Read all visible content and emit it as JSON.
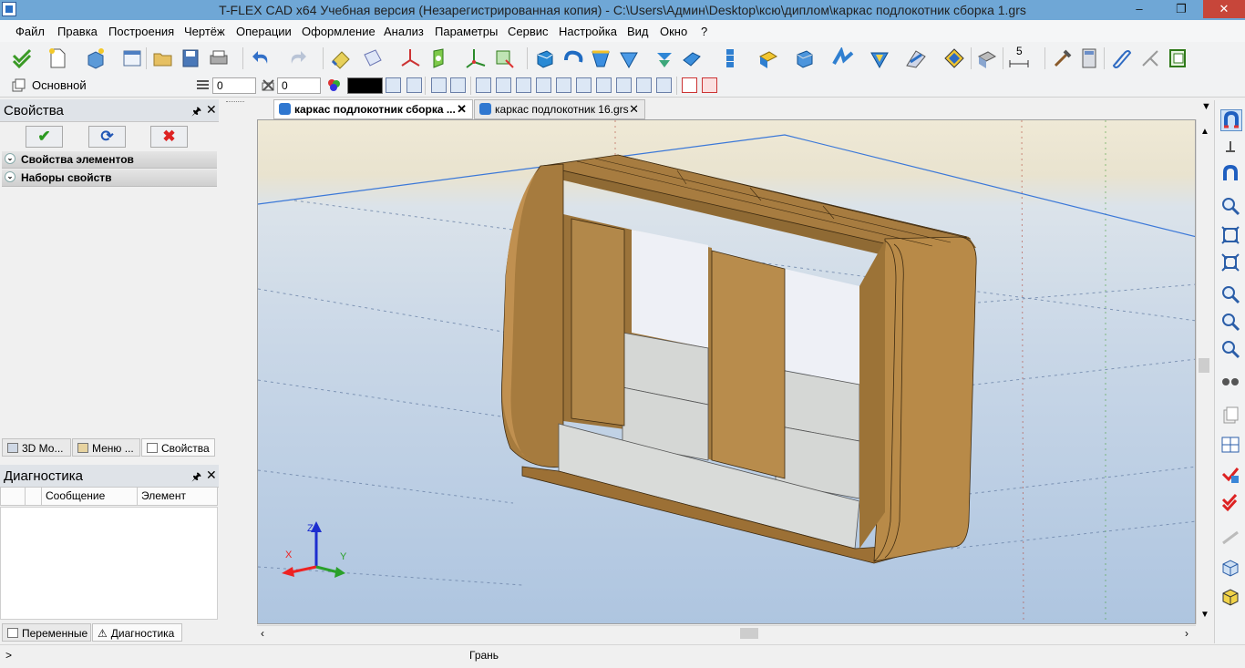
{
  "window": {
    "title": "T-FLEX CAD x64 Учебная версия (Незарегистрированная копия) - C:\\Users\\Админ\\Desktop\\ксю\\диплом\\каркас подлокотник сборка 1.grs",
    "minimize": "–",
    "maximize": "❐",
    "close": "✕"
  },
  "menu": [
    "Файл",
    "Правка",
    "Построения",
    "Чертёж",
    "Операции",
    "Оформление",
    "Анализ",
    "Параметры",
    "Сервис",
    "Настройка",
    "Вид",
    "Окно",
    "?"
  ],
  "toolbar2": {
    "layer": "Основной",
    "level_value": "0",
    "priority_value": "0",
    "color_swatch": "#000000"
  },
  "toolbar1": {
    "dimension_value": "5"
  },
  "properties_panel": {
    "title": "Свойства",
    "ok_symbol": "✔",
    "refresh_symbol": "⟳",
    "cancel_symbol": "✖",
    "sections": [
      "Свойства элементов",
      "Наборы свойств"
    ],
    "tabs": [
      "3D Мо...",
      "Меню ...",
      "Свойства"
    ]
  },
  "diagnostics_panel": {
    "title": "Диагностика",
    "columns": [
      "",
      "",
      "Сообщение",
      "Элемент"
    ],
    "tabs": [
      "Переменные",
      "Диагностика"
    ]
  },
  "document_tabs": [
    {
      "label": "каркас подлокотник сборка ...",
      "active": true
    },
    {
      "label": "каркас подлокотник 16.grs",
      "active": false
    }
  ],
  "axes": {
    "x": "X",
    "y": "Y",
    "z": "Z"
  },
  "status": {
    "left": ">",
    "center": "Грань"
  },
  "colors": {
    "titlebar": "#6fa7d6",
    "wood": "#b98c48",
    "panel_grey": "#d4d7d6"
  }
}
